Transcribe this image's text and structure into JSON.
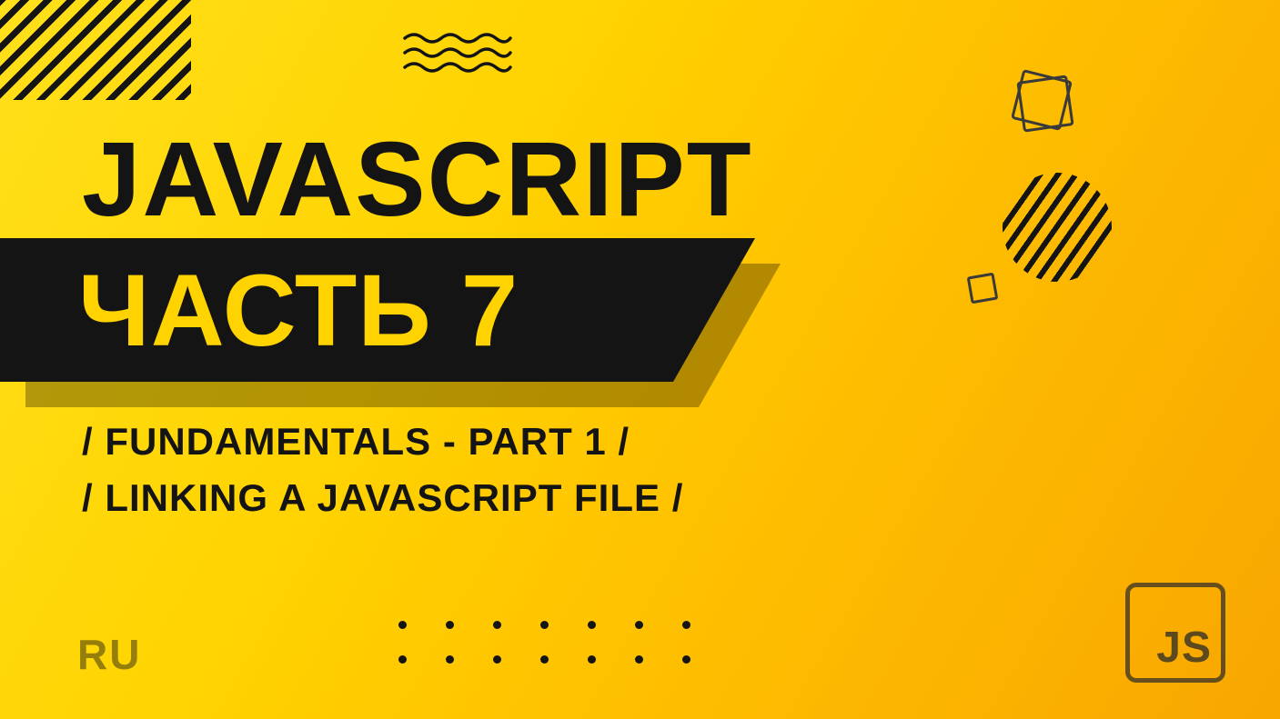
{
  "headline": "JAVASCRIPT",
  "part_label": "ЧАСТЬ 7",
  "subtitle_line1": "/ FUNDAMENTALS - PART 1 /",
  "subtitle_line2": "/ LINKING A JAVASCRIPT FILE /",
  "language": "RU",
  "badge": "JS"
}
